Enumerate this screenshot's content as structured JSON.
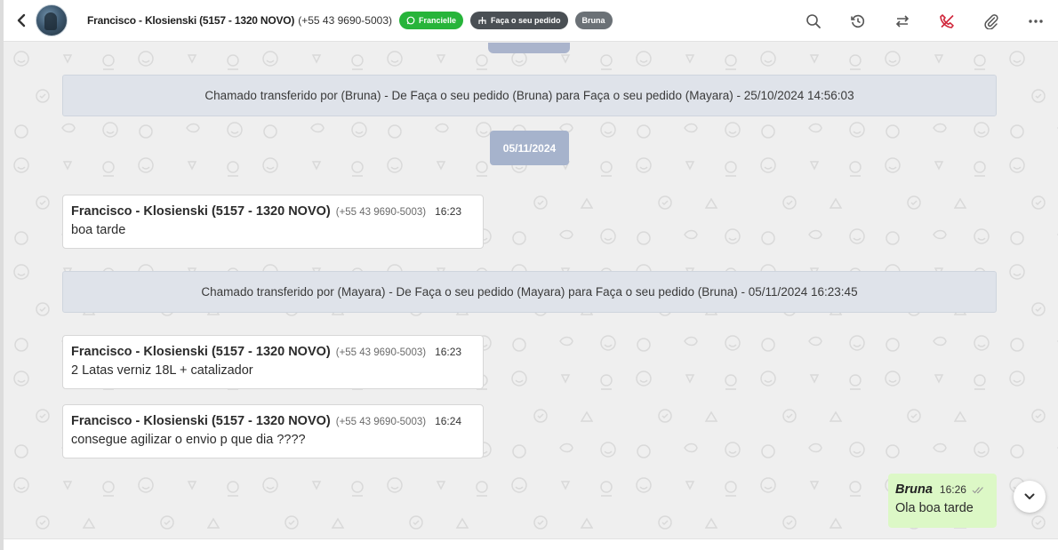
{
  "header": {
    "contact_name": "Francisco - Klosienski (5157 - 1320 NOVO)",
    "contact_phone": "(+55 43 9690-5003)",
    "tags": {
      "whatsapp": "Francielle",
      "queue": "Faça o seu pedido",
      "user": "Bruna"
    },
    "icons": [
      "back-icon",
      "search-icon",
      "history-icon",
      "transfer-icon",
      "end-call-icon",
      "attach-icon",
      "more-icon"
    ]
  },
  "chat": {
    "system_1": "Chamado transferido por (Bruna) - De Faça o seu pedido (Bruna) para Faça o seu pedido (Mayara) - 25/10/2024 14:56:03",
    "date_divider": "05/11/2024",
    "message_1": {
      "name": "Francisco - Klosienski (5157 - 1320 NOVO)",
      "phone": "(+55 43 9690-5003)",
      "time": "16:23",
      "text": "boa tarde"
    },
    "system_2": "Chamado transferido por (Mayara) - De Faça o seu pedido (Mayara) para Faça o seu pedido (Bruna) - 05/11/2024 16:23:45",
    "message_2": {
      "name": "Francisco - Klosienski (5157 - 1320 NOVO)",
      "phone": "(+55 43 9690-5003)",
      "time": "16:23",
      "text": "2 Latas verniz 18L + catalizador"
    },
    "message_3": {
      "name": "Francisco - Klosienski (5157 - 1320 NOVO)",
      "phone": "(+55 43 9690-5003)",
      "time": "16:24",
      "text": "consegue agilizar o envio p que dia ????"
    },
    "outgoing": {
      "name": "Bruna",
      "time": "16:26",
      "text": "Ola boa tarde"
    }
  },
  "colors": {
    "whatsapp_tag": "#27b43a",
    "queue_tag": "#4a4f54",
    "user_tag": "#6b7176",
    "end_call_icon": "#d0263a",
    "system_bg": "#dfe3ea",
    "date_chip": "#a6b3cc",
    "outgoing_bubble": "#dcf8c6"
  }
}
